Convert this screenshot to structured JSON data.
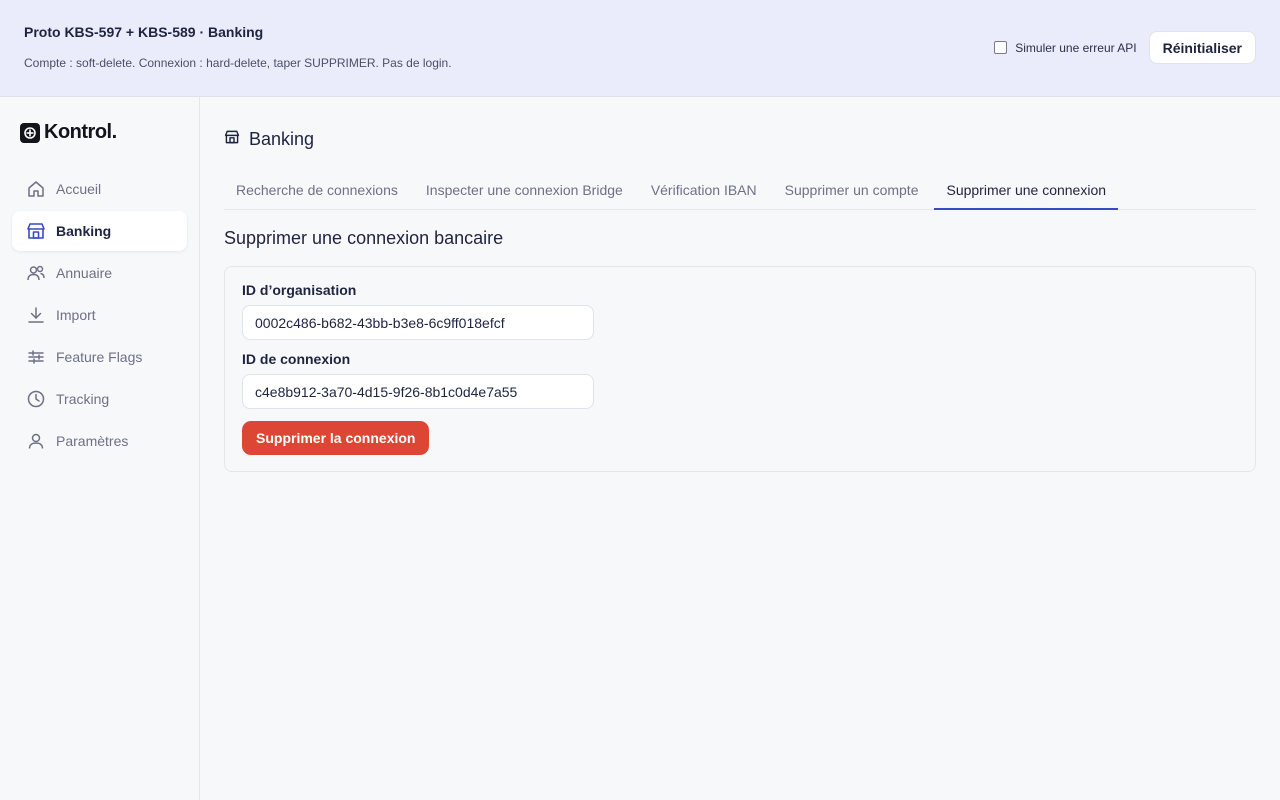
{
  "banner": {
    "title": "Proto KBS-597 + KBS-589 · Banking",
    "subtitle": "Compte : soft-delete. Connexion : hard-delete, taper SUPPRIMER. Pas de login.",
    "simulate_label": "Simuler une erreur API",
    "simulate_checked": false,
    "reset_label": "Réinitialiser"
  },
  "brand": {
    "name": "Kontrol."
  },
  "sidebar": {
    "items": [
      {
        "label": "Accueil",
        "icon": "home-icon",
        "active": false
      },
      {
        "label": "Banking",
        "icon": "bank-icon",
        "active": true
      },
      {
        "label": "Annuaire",
        "icon": "users-icon",
        "active": false
      },
      {
        "label": "Import",
        "icon": "download-icon",
        "active": false
      },
      {
        "label": "Feature Flags",
        "icon": "sliders-icon",
        "active": false
      },
      {
        "label": "Tracking",
        "icon": "clock-icon",
        "active": false
      },
      {
        "label": "Paramètres",
        "icon": "user-icon",
        "active": false
      }
    ]
  },
  "page": {
    "title": "Banking",
    "tabs": [
      {
        "label": "Recherche de connexions",
        "active": false
      },
      {
        "label": "Inspecter une connexion Bridge",
        "active": false
      },
      {
        "label": "Vérification IBAN",
        "active": false
      },
      {
        "label": "Supprimer un compte",
        "active": false
      },
      {
        "label": "Supprimer une connexion",
        "active": true
      }
    ],
    "section_title": "Supprimer une connexion bancaire",
    "form": {
      "org_label": "ID d’organisation",
      "org_value": "0002c486-b682-43bb-b3e8-6c9ff018efcf",
      "conn_label": "ID de connexion",
      "conn_value": "c4e8b912-3a70-4d15-9f26-8b1c0d4e7a55",
      "submit_label": "Supprimer la connexion"
    }
  },
  "colors": {
    "accent": "#3b49c9",
    "danger": "#dd4634",
    "banner_bg": "#eaecfb"
  }
}
